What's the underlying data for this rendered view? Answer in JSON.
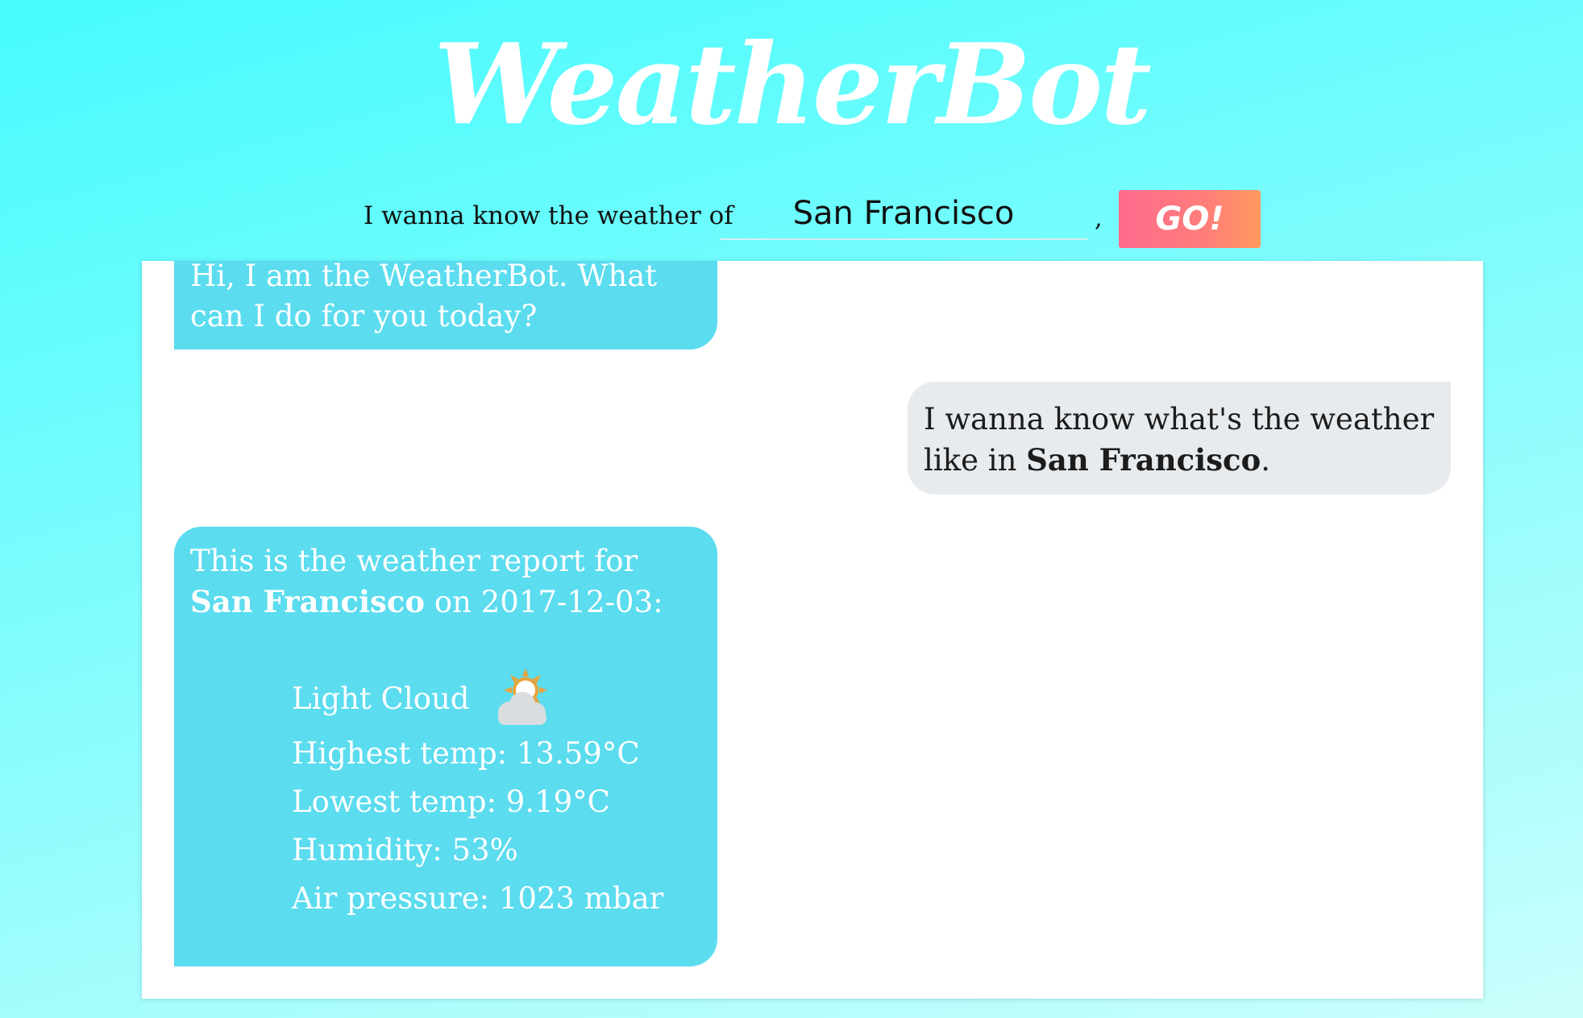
{
  "app": {
    "title": "WeatherBot"
  },
  "query": {
    "label": "I wanna know the weather of",
    "city_value": "San Francisco",
    "comma": ",",
    "go_label": "GO!"
  },
  "colors": {
    "bot_bubble": "#5bdcef",
    "user_bubble": "#e8ebee",
    "go_gradient_start": "#ff6b8e",
    "go_gradient_end": "#ff9a5e",
    "background_top": "#46fbfd",
    "background_bottom": "#cafefc"
  },
  "chat": {
    "bot_greeting": "Hi, I am the WeatherBot. What can I do for you today?",
    "user_message": {
      "prefix": "I wanna know what's the weather like in ",
      "city": "San Francisco",
      "suffix": "."
    },
    "bot_report": {
      "prefix": "This is the weather report for ",
      "city": "San Francisco",
      "middle": " on ",
      "date": "2017-12-03",
      "suffix": ":",
      "condition": "Light Cloud",
      "condition_icon": "light-cloud-icon",
      "highest_temp": "Highest temp: 13.59°C",
      "lowest_temp": "Lowest temp: 9.19°C",
      "humidity": "Humidity: 53%",
      "air_pressure": "Air pressure: 1023 mbar"
    }
  }
}
